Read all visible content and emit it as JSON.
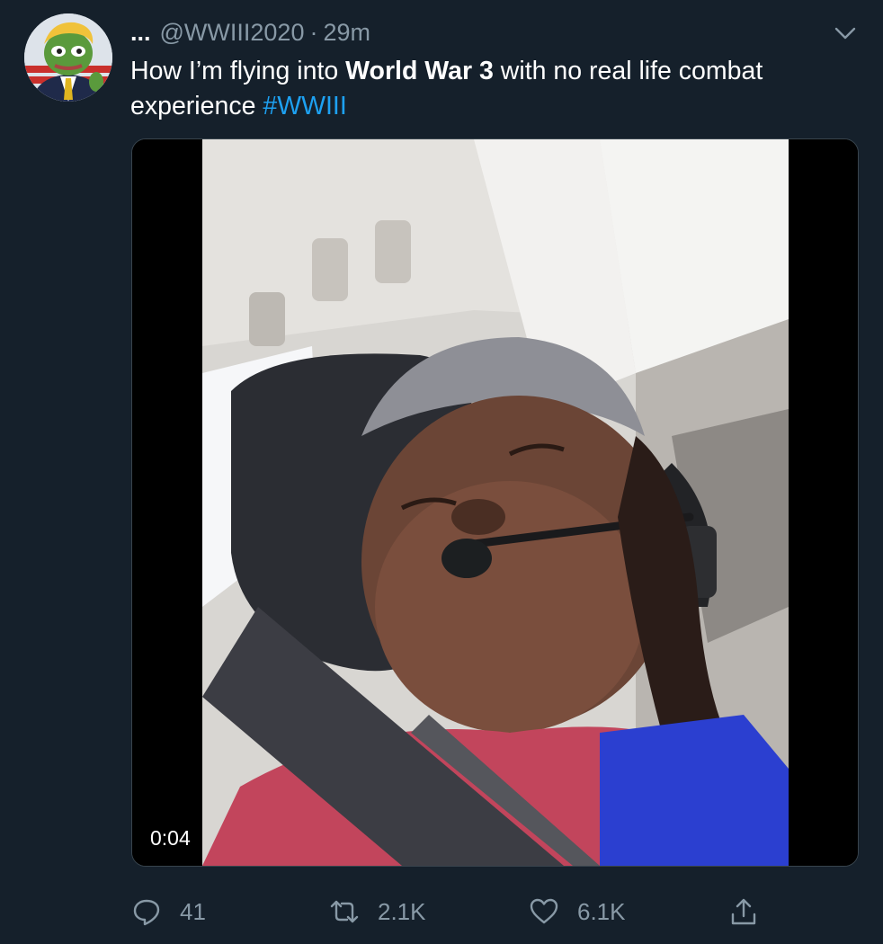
{
  "user": {
    "display_name": "...",
    "handle": "@WWIII2020",
    "separator": "·",
    "time": "29m"
  },
  "tweet": {
    "text_before": "How I’m flying into ",
    "text_bold": "World War 3",
    "text_after": " with no real life combat experience ",
    "hashtag": "#WWIII"
  },
  "media": {
    "type": "video",
    "duration": "0:04"
  },
  "actions": {
    "replies": "41",
    "retweets": "2.1K",
    "likes": "6.1K"
  },
  "icons": {
    "menu": "chevron-down-icon",
    "reply": "reply-icon",
    "retweet": "retweet-icon",
    "like": "heart-icon",
    "share": "share-icon"
  },
  "colors": {
    "background": "#15202b",
    "secondary_text": "#8899a6",
    "accent": "#1da1f2",
    "border": "#38444d"
  }
}
